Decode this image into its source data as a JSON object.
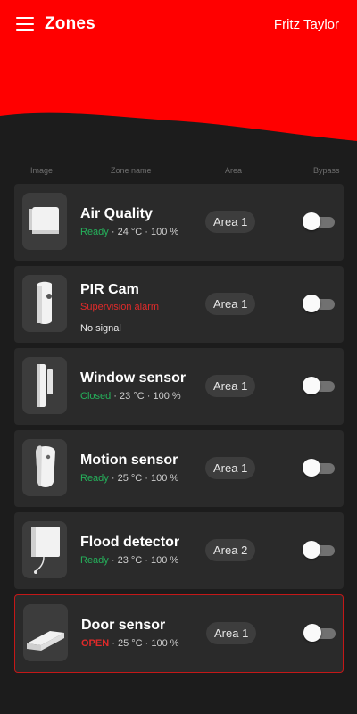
{
  "header": {
    "title": "Zones",
    "user": "Fritz Taylor",
    "accent": "#ff0000"
  },
  "columns": {
    "image": "Image",
    "zone": "Zone name",
    "area": "Area",
    "bypass": "Bypass"
  },
  "zones": [
    {
      "name": "Air Quality",
      "status": "Ready",
      "temp": "24 °C",
      "humidity": "100 %",
      "area": "Area 1",
      "bypass": false,
      "icon": "air-quality-device-icon"
    },
    {
      "name": "PIR Cam",
      "status": "Supervision alarm",
      "signal": "No signal",
      "area": "Area 1",
      "bypass": false,
      "icon": "pir-cam-device-icon"
    },
    {
      "name": "Window sensor",
      "status": "Closed",
      "temp": "23 °C",
      "humidity": "100 %",
      "area": "Area 1",
      "bypass": false,
      "icon": "window-sensor-device-icon"
    },
    {
      "name": "Motion sensor",
      "status": "Ready",
      "temp": "25 °C",
      "humidity": "100 %",
      "area": "Area 1",
      "bypass": false,
      "icon": "motion-sensor-device-icon"
    },
    {
      "name": "Flood detector",
      "status": "Ready",
      "temp": "23 °C",
      "humidity": "100 %",
      "area": "Area 2",
      "bypass": false,
      "icon": "flood-detector-device-icon"
    },
    {
      "name": "Door sensor",
      "status": "OPEN",
      "temp": "25 °C",
      "humidity": "100 %",
      "area": "Area 1",
      "bypass": false,
      "icon": "door-sensor-device-icon"
    }
  ],
  "separator": " · ",
  "colors": {
    "ready": "#25b15b",
    "alarm": "#e12a2a",
    "card": "#2a2a2a",
    "background": "#1c1c1c"
  }
}
